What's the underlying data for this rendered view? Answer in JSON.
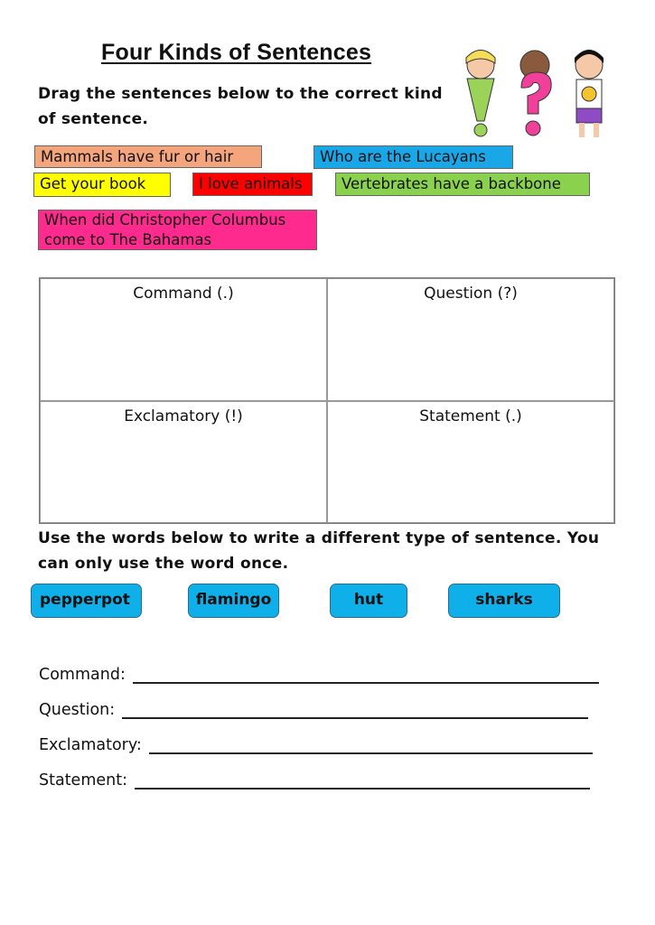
{
  "title": "Four Kinds of Sentences",
  "instructions": {
    "drag": "Drag the sentences below to the correct kind of sentence.",
    "words": "Use the words below to write a different type of sentence. You can only use the word once."
  },
  "illustration": "kids-holding-punctuation-marks",
  "sentence_cards": [
    {
      "text": "Mammals have fur or hair",
      "color": "#f4a57c"
    },
    {
      "text": "Who are the Lucayans",
      "color": "#1aa7e8"
    },
    {
      "text": "Get your book",
      "color": "#ffff00"
    },
    {
      "text": "I love animals",
      "color": "#ff0000"
    },
    {
      "text": "Vertebrates have a backbone",
      "color": "#8ad14e"
    },
    {
      "text": "When did Christopher Columbus come to The Bahamas",
      "color": "#ff2a8d"
    }
  ],
  "drop_zones": [
    {
      "label": "Command (.)"
    },
    {
      "label": "Question (?)"
    },
    {
      "label": "Exclamatory (!)"
    },
    {
      "label": "Statement (.)"
    }
  ],
  "word_buttons": [
    {
      "text": "pepperpot"
    },
    {
      "text": "flamingo"
    },
    {
      "text": "hut"
    },
    {
      "text": "sharks"
    }
  ],
  "word_button_color": "#0fb0ea",
  "answer_lines": [
    {
      "label": "Command:",
      "value": ""
    },
    {
      "label": "Question:",
      "value": ""
    },
    {
      "label": "Exclamatory:",
      "value": ""
    },
    {
      "label": "Statement:",
      "value": ""
    }
  ]
}
